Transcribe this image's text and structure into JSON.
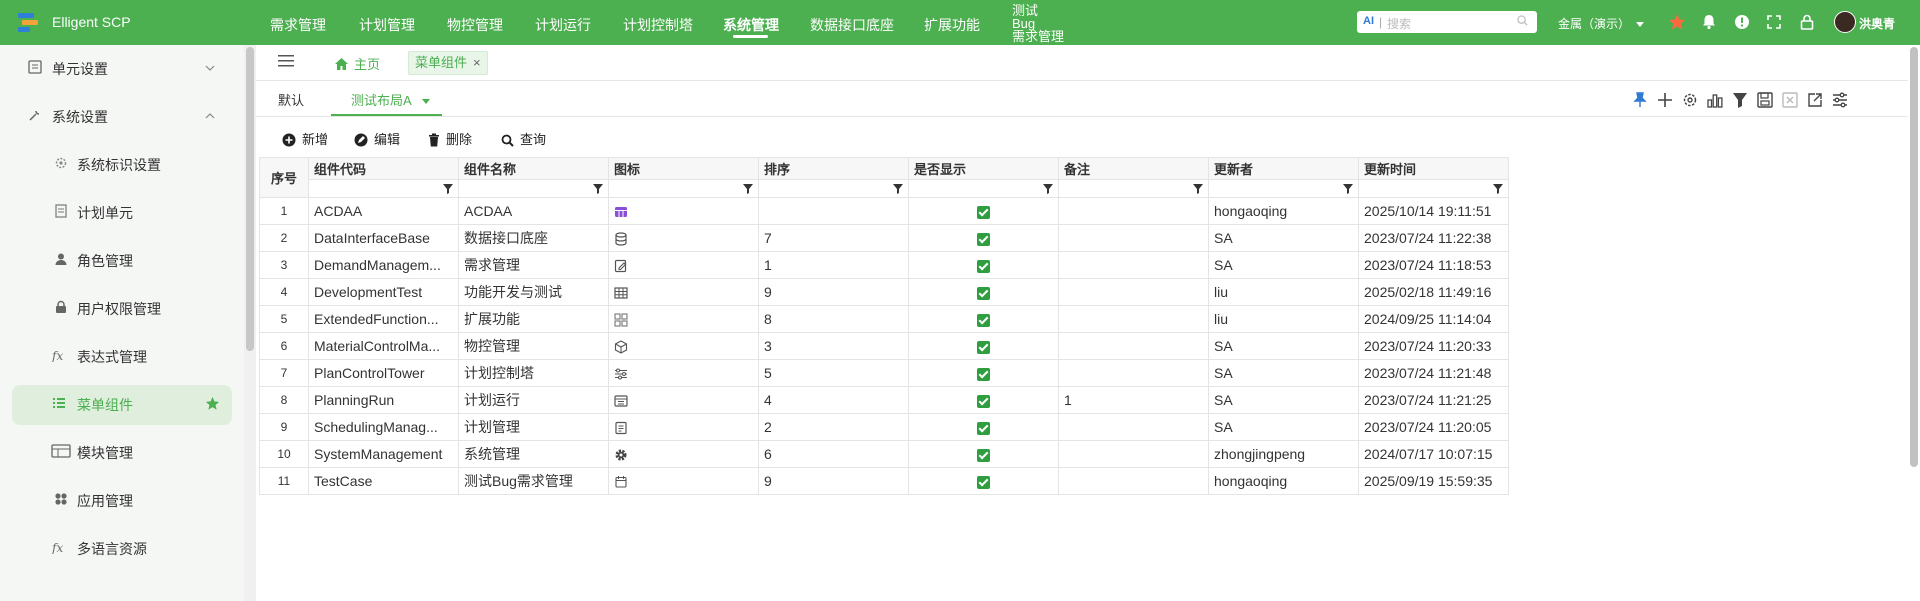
{
  "app": {
    "title": "Elligent SCP"
  },
  "nav": {
    "items": [
      "需求管理",
      "计划管理",
      "物控管理",
      "计划运行",
      "计划控制塔",
      "系统管理",
      "数据接口底座",
      "扩展功能"
    ],
    "active": "系统管理",
    "stacked": [
      "测试",
      "Bug",
      "需求管理"
    ]
  },
  "search": {
    "ai": "AI",
    "placeholder": "搜索"
  },
  "tenant": {
    "label": "金属（演示）"
  },
  "user": {
    "name": "洪奥青"
  },
  "sidebar": {
    "items": [
      {
        "label": "单元设置",
        "icon": "unit-icon"
      },
      {
        "label": "系统设置",
        "icon": "tools-icon"
      },
      {
        "label": "系统标识设置",
        "icon": "gear-icon"
      },
      {
        "label": "计划单元",
        "icon": "doc-icon"
      },
      {
        "label": "角色管理",
        "icon": "role-icon"
      },
      {
        "label": "用户权限管理",
        "icon": "lock-icon"
      },
      {
        "label": "表达式管理",
        "icon": "fx-icon"
      },
      {
        "label": "菜单组件",
        "icon": "list-icon"
      },
      {
        "label": "模块管理",
        "icon": "module-icon"
      },
      {
        "label": "应用管理",
        "icon": "app-icon"
      },
      {
        "label": "多语言资源",
        "icon": "fx-icon"
      }
    ]
  },
  "tabs": {
    "home": "主页",
    "current": "菜单组件",
    "close": "×"
  },
  "layouts": {
    "default": "默认",
    "active": "测试布局A"
  },
  "toolbar": {
    "add": "新增",
    "edit": "编辑",
    "delete": "删除",
    "query": "查询"
  },
  "table": {
    "columns": [
      "序号",
      "组件代码",
      "组件名称",
      "图标",
      "排序",
      "是否显示",
      "备注",
      "更新者",
      "更新时间"
    ],
    "rows": [
      {
        "seq": "1",
        "code": "ACDAA",
        "name": "ACDAA",
        "icon": "calendar-purple-icon",
        "sort": "",
        "shown": true,
        "note": "",
        "updater": "hongaoqing",
        "time": "2025/10/14 19:11:51"
      },
      {
        "seq": "2",
        "code": "DataInterfaceBase",
        "name": "数据接口底座",
        "icon": "database-icon",
        "sort": "7",
        "shown": true,
        "note": "",
        "updater": "SA",
        "time": "2023/07/24 11:22:38"
      },
      {
        "seq": "3",
        "code": "DemandManagem...",
        "name": "需求管理",
        "icon": "edit-doc-icon",
        "sort": "1",
        "shown": true,
        "note": "",
        "updater": "SA",
        "time": "2023/07/24 11:18:53"
      },
      {
        "seq": "4",
        "code": "DevelopmentTest",
        "name": "功能开发与测试",
        "icon": "grid-icon",
        "sort": "9",
        "shown": true,
        "note": "",
        "updater": "liu",
        "time": "2025/02/18 11:49:16"
      },
      {
        "seq": "5",
        "code": "ExtendedFunction...",
        "name": "扩展功能",
        "icon": "apps-icon",
        "sort": "8",
        "shown": true,
        "note": "",
        "updater": "liu",
        "time": "2024/09/25 11:14:04"
      },
      {
        "seq": "6",
        "code": "MaterialControlMa...",
        "name": "物控管理",
        "icon": "cube-icon",
        "sort": "3",
        "shown": true,
        "note": "",
        "updater": "SA",
        "time": "2023/07/24 11:20:33"
      },
      {
        "seq": "7",
        "code": "PlanControlTower",
        "name": "计划控制塔",
        "icon": "sliders-icon",
        "sort": "5",
        "shown": true,
        "note": "",
        "updater": "SA",
        "time": "2023/07/24 11:21:48"
      },
      {
        "seq": "8",
        "code": "PlanningRun",
        "name": "计划运行",
        "icon": "calendar-list-icon",
        "sort": "4",
        "shown": true,
        "note": "1",
        "updater": "SA",
        "time": "2023/07/24 11:21:25"
      },
      {
        "seq": "9",
        "code": "SchedulingManag...",
        "name": "计划管理",
        "icon": "clipboard-icon",
        "sort": "2",
        "shown": true,
        "note": "",
        "updater": "SA",
        "time": "2023/07/24 11:20:05"
      },
      {
        "seq": "10",
        "code": "SystemManagement",
        "name": "系统管理",
        "icon": "gear-icon",
        "sort": "6",
        "shown": true,
        "note": "",
        "updater": "zhongjingpeng",
        "time": "2024/07/17 10:07:15"
      },
      {
        "seq": "11",
        "code": "TestCase",
        "name": "测试Bug需求管理",
        "icon": "calendar-icon",
        "sort": "9",
        "shown": true,
        "note": "",
        "updater": "hongaoqing",
        "time": "2025/09/19 15:59:35"
      }
    ]
  }
}
